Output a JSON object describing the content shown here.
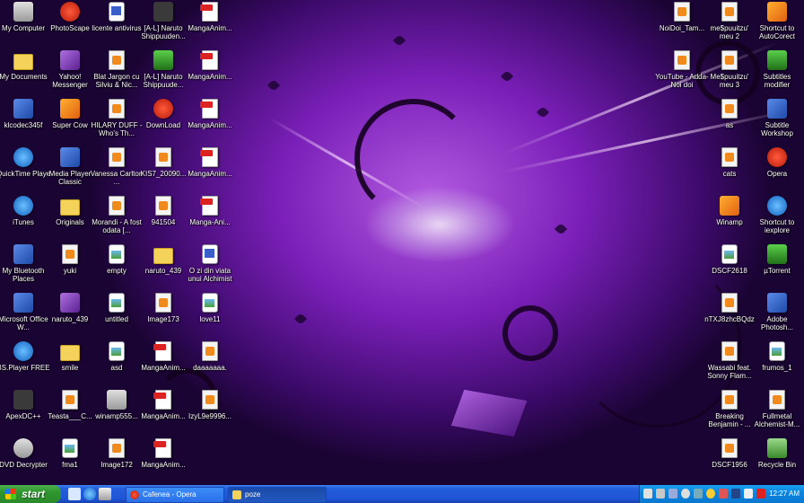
{
  "desktop": {
    "icons": [
      {
        "label": "My Computer",
        "icon": "computer-icon"
      },
      {
        "label": "My Documents",
        "icon": "documents-icon"
      },
      {
        "label": "klcodec345f",
        "icon": "codec-icon"
      },
      {
        "label": "QuickTime Player",
        "icon": "quicktime-icon"
      },
      {
        "label": "iTunes",
        "icon": "itunes-icon"
      },
      {
        "label": "My Bluetooth Places",
        "icon": "bluetooth-icon"
      },
      {
        "label": "Microsoft Office W...",
        "icon": "word-icon"
      },
      {
        "label": "BS.Player FREE",
        "icon": "bsplayer-icon"
      },
      {
        "label": "ApexDC++",
        "icon": "apexdc-icon"
      },
      {
        "label": "DVD Decrypter",
        "icon": "dvd-icon"
      },
      {
        "label": "PhotoScape",
        "icon": "photoscape-icon"
      },
      {
        "label": "Yahoo! Messenger",
        "icon": "yahoo-icon"
      },
      {
        "label": "Super Cow",
        "icon": "app-icon"
      },
      {
        "label": "Media Player Classic",
        "icon": "mpc-icon"
      },
      {
        "label": "Originals",
        "icon": "folder-icon"
      },
      {
        "label": "yuki",
        "icon": "file-icon"
      },
      {
        "label": "naruto_439",
        "icon": "archive-icon"
      },
      {
        "label": "smile",
        "icon": "folder-icon"
      },
      {
        "label": "Teasta___C...",
        "icon": "file-icon"
      },
      {
        "label": "fma1",
        "icon": "image-icon"
      },
      {
        "label": "licente antivirus",
        "icon": "text-icon"
      },
      {
        "label": "Blat Jargon cu Silviu & Nic...",
        "icon": "file-icon"
      },
      {
        "label": "HILARY DUFF - Who's Th...",
        "icon": "file-icon"
      },
      {
        "label": "Vanessa Carlton ...",
        "icon": "file-icon"
      },
      {
        "label": "Morandi - A fost odata [...",
        "icon": "file-icon"
      },
      {
        "label": "empty",
        "icon": "image-icon"
      },
      {
        "label": "untitled",
        "icon": "image-icon"
      },
      {
        "label": "asd",
        "icon": "image-icon"
      },
      {
        "label": "winamp555...",
        "icon": "installer-icon"
      },
      {
        "label": "Image172",
        "icon": "file-icon"
      },
      {
        "label": "[A-L] Naruto Shippuuden...",
        "icon": "video-icon"
      },
      {
        "label": "[A-L] Naruto Shippuude...",
        "icon": "subtitle-icon"
      },
      {
        "label": "DownLoad",
        "icon": "opera-icon"
      },
      {
        "label": "KIS7_20090...",
        "icon": "file-icon"
      },
      {
        "label": "941504",
        "icon": "file-icon"
      },
      {
        "label": "naruto_439",
        "icon": "folder-icon"
      },
      {
        "label": "Image173",
        "icon": "file-icon"
      },
      {
        "label": "MangaAnim...",
        "icon": "pdf-icon"
      },
      {
        "label": "MangaAnim...",
        "icon": "pdf-icon"
      },
      {
        "label": "MangaAnim...",
        "icon": "pdf-icon"
      },
      {
        "label": "MangaAnim...",
        "icon": "pdf-icon"
      },
      {
        "label": "MangaAnim...",
        "icon": "pdf-icon"
      },
      {
        "label": "MangaAnim...",
        "icon": "pdf-icon"
      },
      {
        "label": "MangaAnim...",
        "icon": "pdf-icon"
      },
      {
        "label": "Manga-Ani...",
        "icon": "pdf-icon"
      },
      {
        "label": "O zi din viata unui Alchimist",
        "icon": "word-doc-icon"
      },
      {
        "label": "love11",
        "icon": "image-icon"
      },
      {
        "label": "daaaaaaa.",
        "icon": "file-icon"
      },
      {
        "label": "IzyL9e9996...",
        "icon": "file-icon"
      },
      {
        "label": "NoiDoi_Tam...",
        "icon": "file-icon"
      },
      {
        "label": "YouTube - Adda-Noi doi",
        "icon": "file-icon"
      },
      {
        "label": "me$puuitzu' meu 2",
        "icon": "file-icon"
      },
      {
        "label": "Me$puuitzu' meu 3",
        "icon": "file-icon"
      },
      {
        "label": "as",
        "icon": "file-icon"
      },
      {
        "label": "cats",
        "icon": "file-icon"
      },
      {
        "label": "Winamp",
        "icon": "winamp-icon"
      },
      {
        "label": "DSCF2618",
        "icon": "image-icon"
      },
      {
        "label": "nTXJ8zhcBQdz",
        "icon": "file-icon"
      },
      {
        "label": "Wassabi feat. Sonny Flam...",
        "icon": "file-icon"
      },
      {
        "label": "Breaking Benjamin - ...",
        "icon": "file-icon"
      },
      {
        "label": "DSCF1956",
        "icon": "file-icon"
      },
      {
        "label": "Shortcut to AutoCorect",
        "icon": "puzzle-icon"
      },
      {
        "label": "Subtitles modifier",
        "icon": "subtitle-icon"
      },
      {
        "label": "Subtitle Workshop",
        "icon": "subtitle-icon"
      },
      {
        "label": "Opera",
        "icon": "opera-icon"
      },
      {
        "label": "Shortcut to iexplore",
        "icon": "ie-icon"
      },
      {
        "label": "µTorrent",
        "icon": "utorrent-icon"
      },
      {
        "label": "Adobe Photosh...",
        "icon": "photoshop-icon"
      },
      {
        "label": "frumos_1",
        "icon": "image-icon"
      },
      {
        "label": "Fullmetal Alchemist-M...",
        "icon": "file-icon"
      },
      {
        "label": "Recycle Bin",
        "icon": "recycle-bin-icon"
      }
    ]
  },
  "taskbar": {
    "start_label": "start",
    "tasks": [
      {
        "label": "Cafenea - Opera",
        "icon": "opera-icon"
      },
      {
        "label": "poze",
        "icon": "folder-icon"
      }
    ],
    "clock": "12:27 AM"
  },
  "colors": {
    "taskbar": "#245edc",
    "start": "#2e962e",
    "tray": "#0c86e0"
  }
}
